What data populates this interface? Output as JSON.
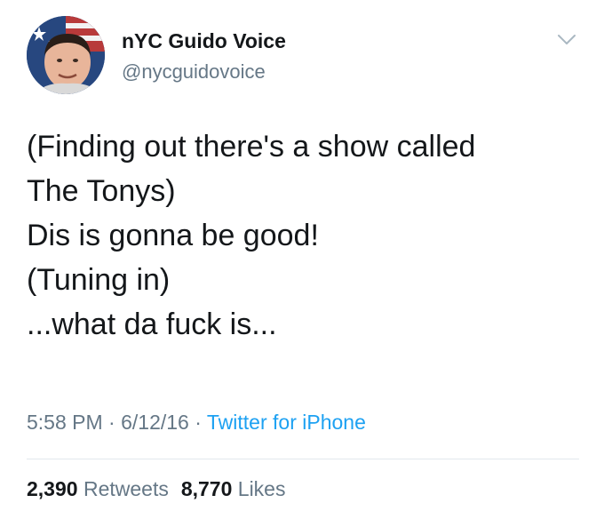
{
  "author": {
    "display_name": "nYC Guido Voice",
    "handle": "@nycguidovoice",
    "avatar_icon": "profile-photo"
  },
  "menu_icon": "chevron-down-icon",
  "tweet": {
    "lines": [
      "(Finding out there's a show called",
      "The Tonys)",
      "Dis is gonna be good!",
      "(Tuning in)",
      "...what da fuck is..."
    ]
  },
  "meta": {
    "time": "5:58 PM",
    "separator": "·",
    "date": "6/12/16",
    "source": "Twitter for iPhone"
  },
  "stats": {
    "retweets_count": "2,390",
    "retweets_label": "Retweets",
    "likes_count": "8,770",
    "likes_label": "Likes"
  },
  "colors": {
    "text": "#14171a",
    "secondary": "#657786",
    "link": "#1da1f2",
    "divider": "#e1e8ed"
  }
}
